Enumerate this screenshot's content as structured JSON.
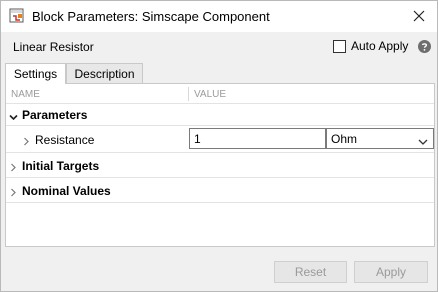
{
  "window": {
    "title": "Block Parameters: Simscape Component",
    "icon": "simulink-block-icon",
    "close_icon": "close-icon"
  },
  "header": {
    "block_name": "Linear Resistor",
    "auto_apply_label": "Auto Apply",
    "auto_apply_checked": false,
    "help_icon": "help-icon"
  },
  "tabs": [
    {
      "label": "Settings",
      "active": true
    },
    {
      "label": "Description",
      "active": false
    }
  ],
  "table": {
    "columns": {
      "name": "NAME",
      "value": "VALUE"
    },
    "sections": [
      {
        "label": "Parameters",
        "expanded": true,
        "items": [
          {
            "label": "Resistance",
            "value": "1",
            "unit": "Ohm",
            "expanded": false
          }
        ]
      },
      {
        "label": "Initial Targets",
        "expanded": false
      },
      {
        "label": "Nominal Values",
        "expanded": false
      }
    ]
  },
  "buttons": {
    "reset": "Reset",
    "apply": "Apply"
  },
  "colors": {
    "title_bg": "#ffffff",
    "dialog_bg": "#f0f0f0",
    "disabled_text": "#9a9a9a",
    "header_text": "#9b9b9b"
  }
}
